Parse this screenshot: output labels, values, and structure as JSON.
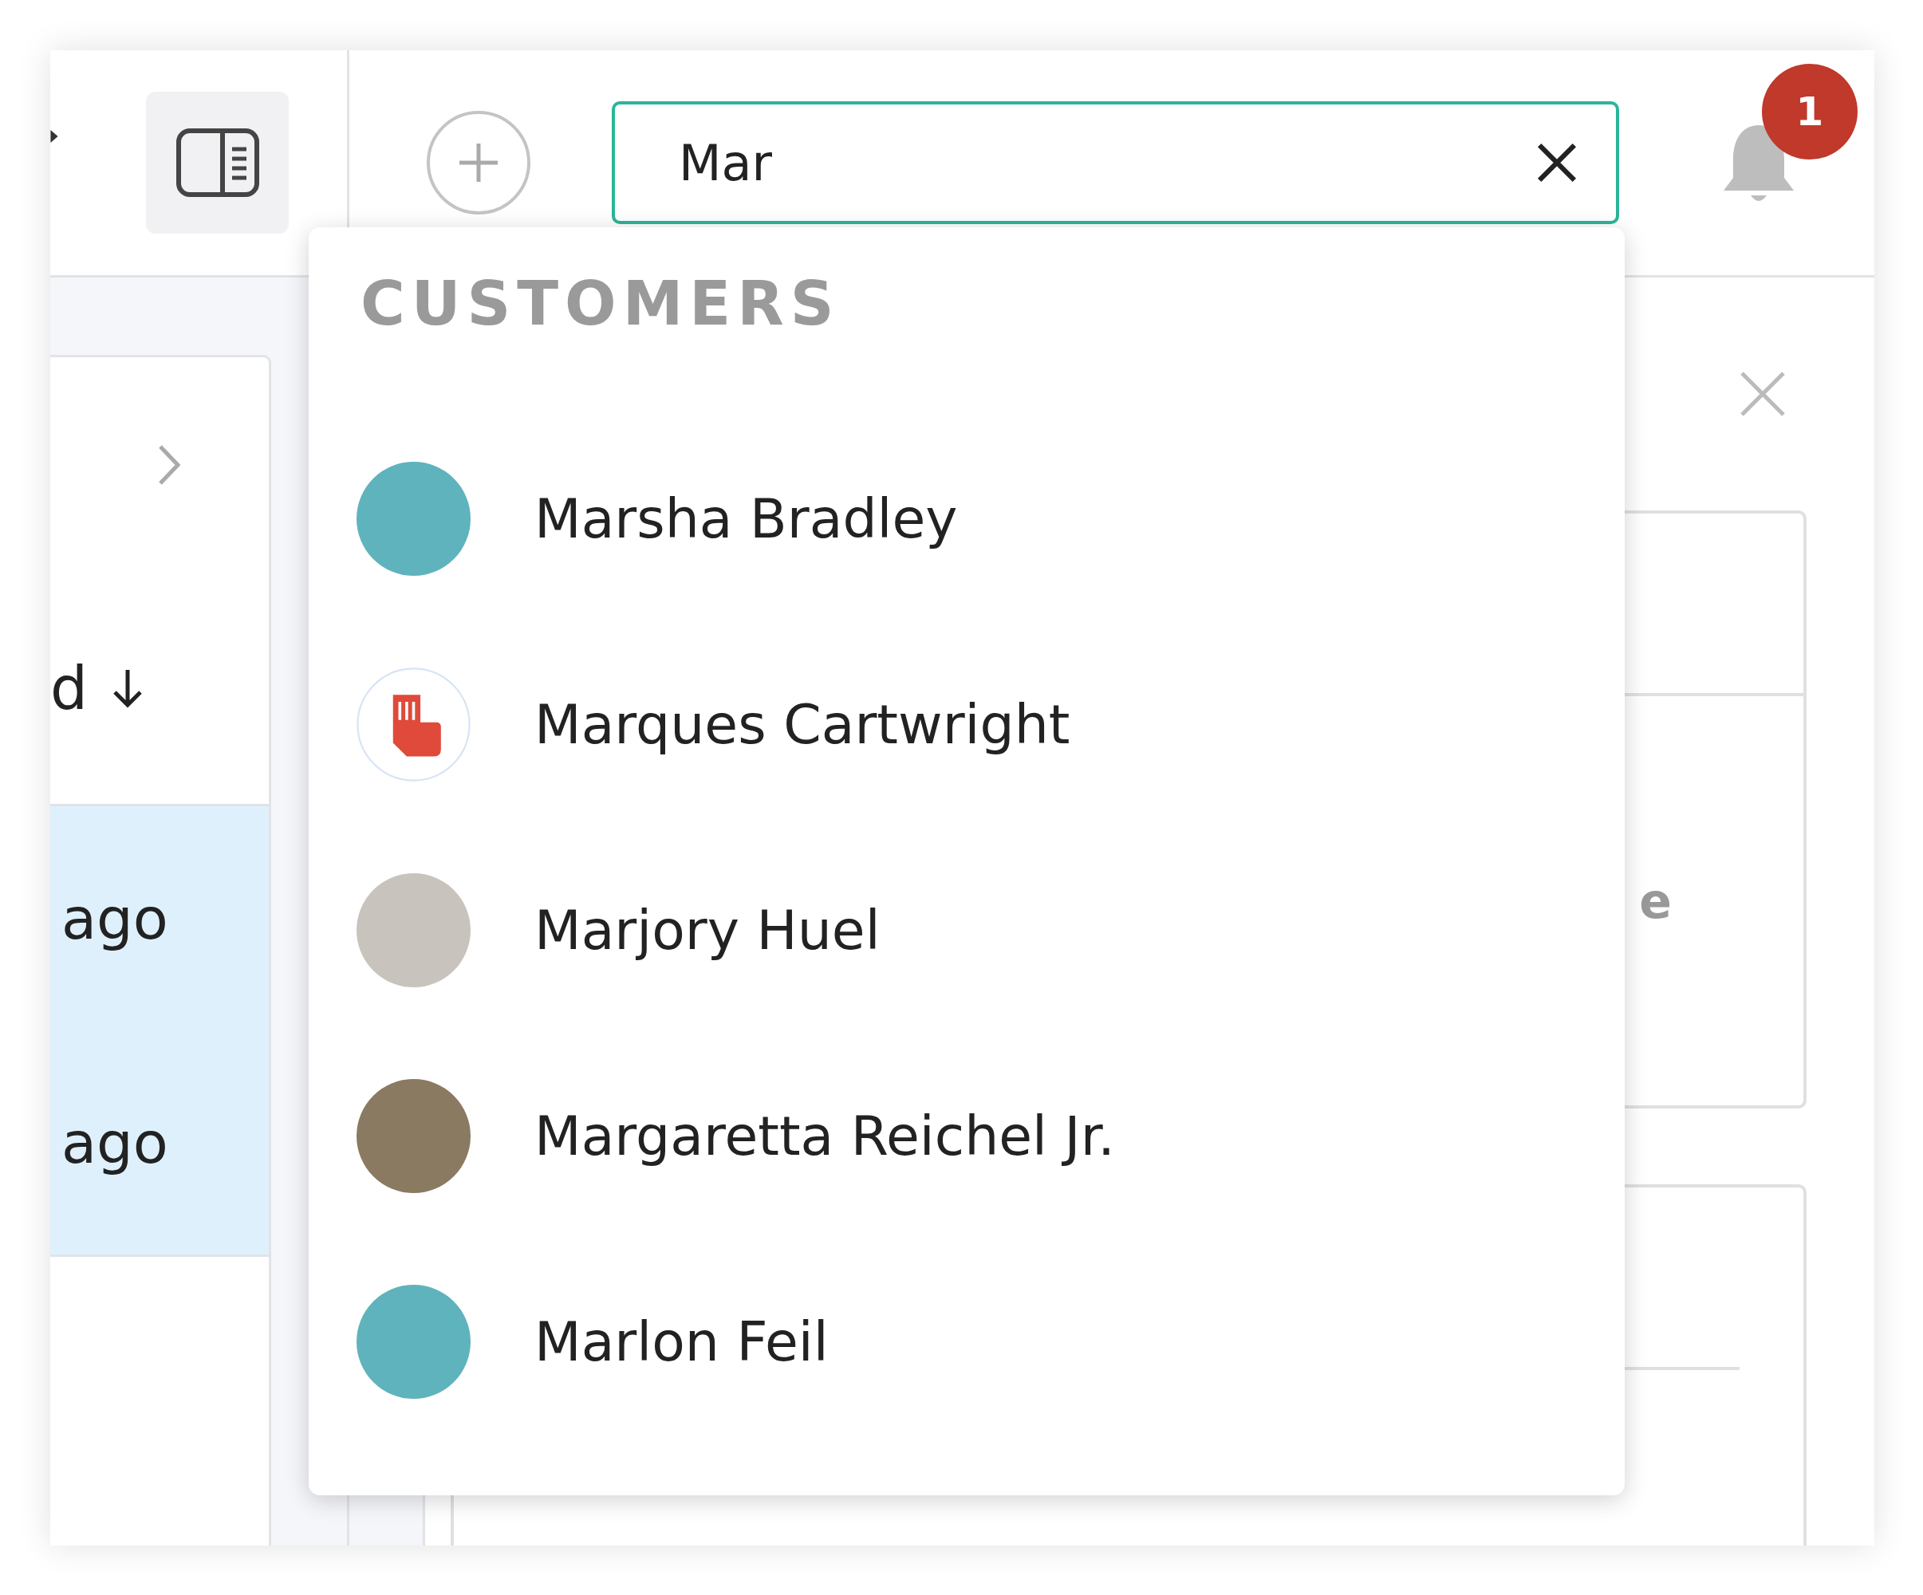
{
  "sidebar": {
    "sort_label": "d",
    "rows": [
      {
        "text": "ago",
        "selected": true
      },
      {
        "text": "ago",
        "selected": true
      }
    ]
  },
  "search": {
    "value": "Mar"
  },
  "notifications": {
    "badge": "1"
  },
  "results": {
    "heading": "CUSTOMERS",
    "customers": [
      {
        "name": "Marsha Bradley",
        "kind": "photo"
      },
      {
        "name": "Marques Cartwright",
        "kind": "logo"
      },
      {
        "name": "Marjory Huel",
        "kind": "photo"
      },
      {
        "name": "Margaretta Reichel Jr.",
        "kind": "photo"
      },
      {
        "name": "Marlon Feil",
        "kind": "photo"
      }
    ]
  },
  "detail": {
    "text": "e"
  }
}
